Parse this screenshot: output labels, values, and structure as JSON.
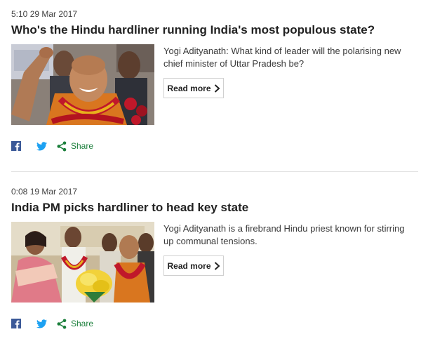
{
  "colors": {
    "text": "#222222",
    "timestamp": "#404040",
    "share_green": "#1b7f3b",
    "facebook_blue": "#3b5998",
    "twitter_blue": "#1da1f2",
    "divider": "#e3e3e3"
  },
  "stories": [
    {
      "timestamp": "5:10 29 Mar 2017",
      "headline": "Who's the Hindu hardliner running India's most populous state?",
      "summary": "Yogi Adityanath: What kind of leader will the polarising new chief minister of Uttar Pradesh be?",
      "read_more": "Read more",
      "share_label": "Share",
      "image_desc": "photo-celebration-garlands"
    },
    {
      "timestamp": "0:08 19 Mar 2017",
      "headline": "India PM picks hardliner to head key state",
      "summary": "Yogi Adityanath is a firebrand Hindu priest known for stirring up communal tensions.",
      "read_more": "Read more",
      "share_label": "Share",
      "image_desc": "photo-bouquet-ceremony"
    }
  ],
  "icons": {
    "facebook": "facebook-icon",
    "twitter": "twitter-icon",
    "share": "share-icon",
    "read_more_arrow": "chevron-right-icon"
  }
}
